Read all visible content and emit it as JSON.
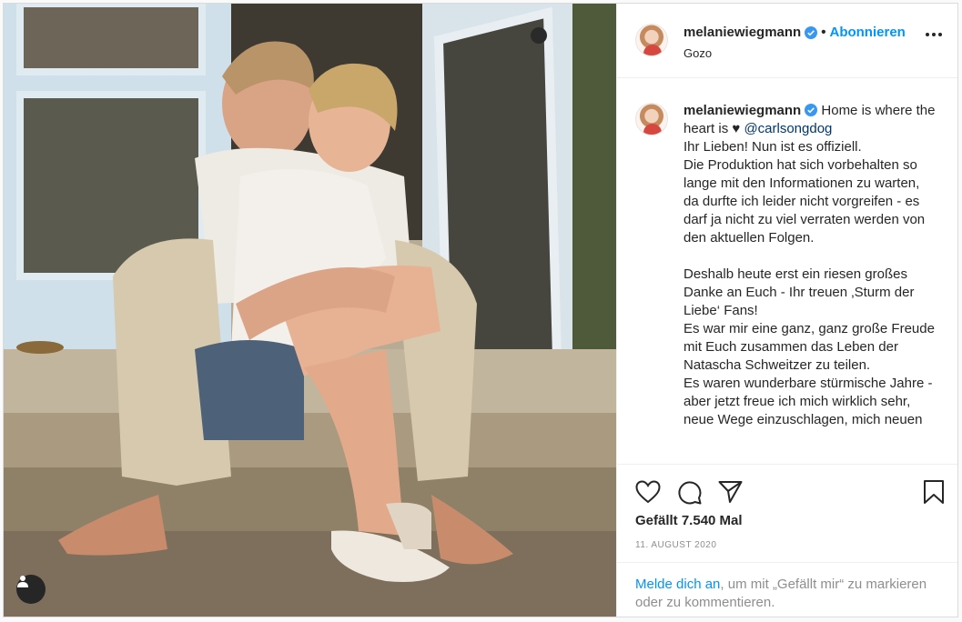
{
  "post": {
    "username": "melaniewiegmann",
    "follow_label": "Abonnieren",
    "separator": "•",
    "location": "Gozo",
    "caption_lead": "Home is where the heart is ♥ ",
    "caption_mention": "@carlsongdog",
    "caption_body": "Ihr Lieben! Nun ist es offiziell.\nDie Produktion hat sich vorbehalten so lange mit den Informationen zu warten, da durfte ich leider nicht vorgreifen - es darf ja nicht zu viel verraten werden von den aktuellen Folgen.\n\nDeshalb heute erst ein riesen großes Danke an Euch - Ihr treuen ‚Sturm der Liebe‘ Fans!\nEs war mir eine ganz, ganz große Freude mit Euch zusammen das Leben der Natascha Schweitzer zu teilen.\nEs waren wunderbare stürmische Jahre - aber jetzt freue ich mich wirklich sehr, neue Wege einzuschlagen, mich neuen",
    "likes_text": "Gefällt 7.540 Mal",
    "date_text": "11. AUGUST 2020",
    "login_link": "Melde dich an",
    "login_rest": ", um mit „Gefällt mir“ zu markieren oder zu kommentieren."
  },
  "icons": {
    "verified": "verified-badge-icon",
    "more": "more-options-icon",
    "like": "heart-icon",
    "comment": "comment-icon",
    "share": "share-icon",
    "save": "bookmark-icon",
    "tags": "user-tag-icon"
  },
  "colors": {
    "accent": "#0095f6",
    "text": "#262626",
    "muted": "#8e8e8e",
    "border": "#dbdbdb"
  }
}
